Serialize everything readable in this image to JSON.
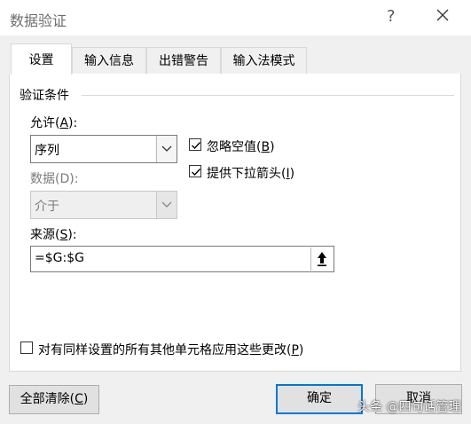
{
  "window": {
    "title": "数据验证",
    "help": "?",
    "close_icon": "close-icon"
  },
  "tabs": [
    {
      "label": "设置"
    },
    {
      "label": "输入信息"
    },
    {
      "label": "出错警告"
    },
    {
      "label": "输入法模式"
    }
  ],
  "criteria": {
    "group_label": "验证条件",
    "allow_label": "允许(",
    "allow_key": "A",
    "allow_suffix": "):",
    "allow_value": "序列",
    "data_label": "数据(D):",
    "data_value": "介于",
    "ignore_blank": {
      "label": "忽略空值(",
      "key": "B",
      "suffix": ")",
      "checked": true
    },
    "dropdown": {
      "label": "提供下拉箭头(",
      "key": "I",
      "suffix": ")",
      "checked": true
    },
    "source_label": "来源(",
    "source_key": "S",
    "source_suffix": "):",
    "source_value": "=$G:$G"
  },
  "apply_all": {
    "label": "对有同样设置的所有其他单元格应用这些更改(",
    "key": "P",
    "suffix": ")",
    "checked": false
  },
  "buttons": {
    "clear": {
      "label": "全部清除(",
      "key": "C",
      "suffix": ")"
    },
    "ok": "确定",
    "cancel": "取消"
  },
  "watermark": "头条 @四句话管理",
  "colors": {
    "accent": "#0078d7",
    "check": "#000000"
  }
}
